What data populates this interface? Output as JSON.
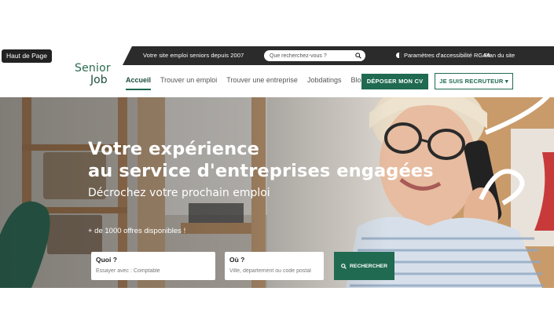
{
  "skip_link": "Haut de Page",
  "topbar": {
    "tagline": "Votre site emploi seniors depuis 2007",
    "search_placeholder": "Que recherchez-vous ?",
    "accessibility": "Paramètres d'accessibilité RGAA",
    "sitemap": "Plan du site"
  },
  "logo": {
    "line1": "Senior",
    "line2": "Job"
  },
  "nav": {
    "items": [
      {
        "label": "Accueil",
        "active": true
      },
      {
        "label": "Trouver un emploi"
      },
      {
        "label": "Trouver une entreprise"
      },
      {
        "label": "Jobdatings"
      },
      {
        "label": "Blog"
      }
    ]
  },
  "header": {
    "cv_button": "DÉPOSER MON CV",
    "recruiter_button": "JE SUIS RECRUTEUR ▾"
  },
  "hero": {
    "title_line1": "Votre expérience",
    "title_line2": "au service d'entreprises engagées",
    "subtitle": "Décrochez votre prochain emploi",
    "offers": "+ de 1000 offres disponibles !"
  },
  "search": {
    "what_label": "Quoi ?",
    "what_placeholder": "Essayer avec : Comptable",
    "where_label": "Où ?",
    "where_placeholder": "Ville, département ou code postal",
    "button": "RECHERCHER"
  },
  "colors": {
    "brand_green": "#1f6a50",
    "topbar": "#2b2b2b"
  },
  "icons": [
    "search-icon",
    "accessibility-icon"
  ]
}
